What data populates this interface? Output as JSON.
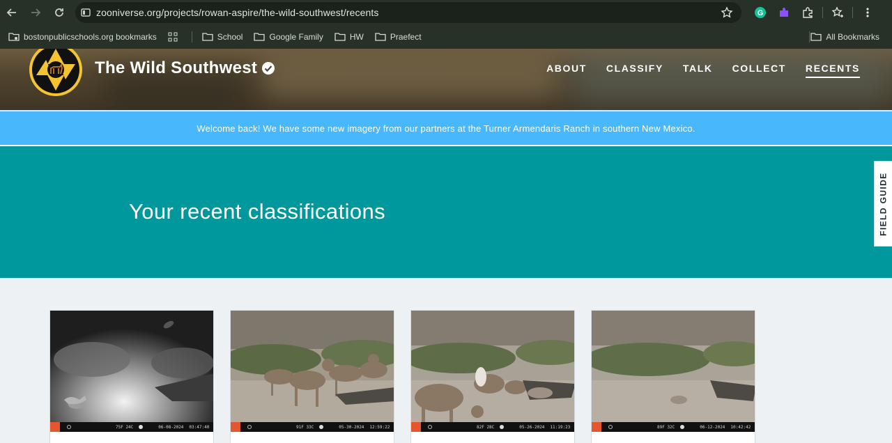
{
  "browser": {
    "url": "zooniverse.org/projects/rowan-aspire/the-wild-southwest/recents",
    "bookmarks": [
      {
        "label": "bostonpublicschools.org bookmarks"
      },
      {
        "label": "School"
      },
      {
        "label": "Google Family"
      },
      {
        "label": "HW"
      },
      {
        "label": "Praefect"
      }
    ],
    "all_bookmarks_label": "All Bookmarks"
  },
  "site": {
    "project_title": "The Wild Southwest",
    "nav": [
      {
        "label": "ABOUT",
        "active": false
      },
      {
        "label": "CLASSIFY",
        "active": false
      },
      {
        "label": "TALK",
        "active": false
      },
      {
        "label": "COLLECT",
        "active": false
      },
      {
        "label": "RECENTS",
        "active": true
      }
    ],
    "announcement": "Welcome back! We have some new imagery from our partners at the Turner Armendaris Ranch in southern New Mexico.",
    "hero_title": "Your recent classifications",
    "field_guide_label": "FIELD GUIDE"
  },
  "classifications": [
    {
      "scene": "night-fox",
      "temp": "75F  24C",
      "date": "06-08-2024",
      "time": "03:47:40"
    },
    {
      "scene": "sheep-herd",
      "temp": "91F  33C",
      "date": "05-30-2024",
      "time": "12:59:22"
    },
    {
      "scene": "sheep-drinking",
      "temp": "82F  28C",
      "date": "05-26-2024",
      "time": "11:19:23"
    },
    {
      "scene": "empty-trough",
      "temp": "89F  32C",
      "date": "06-12-2024",
      "time": "10:42:42"
    }
  ],
  "colors": {
    "chrome_bg": "#273127",
    "announcement_bg": "#48b7fc",
    "hero_bg": "#00979d",
    "logo_yellow": "#f4c430"
  }
}
